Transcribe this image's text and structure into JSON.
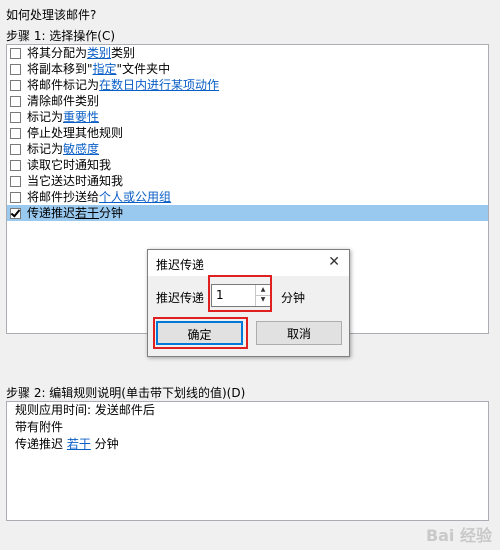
{
  "header": {
    "question": "如何处理该邮件?",
    "step1_label": "步骤 1: 选择操作(C)"
  },
  "actions": [
    {
      "parts": [
        {
          "t": "将其分配为 "
        },
        {
          "t": "类别",
          "link": true
        },
        {
          "t": " 类别"
        }
      ],
      "checked": false
    },
    {
      "parts": [
        {
          "t": "将副本移到\""
        },
        {
          "t": "指定",
          "link": true
        },
        {
          "t": "\"文件夹中"
        }
      ],
      "checked": false
    },
    {
      "parts": [
        {
          "t": "将邮件标记为 "
        },
        {
          "t": "在数日内进行某项动作",
          "link": true
        }
      ],
      "checked": false
    },
    {
      "parts": [
        {
          "t": "清除邮件类别"
        }
      ],
      "checked": false
    },
    {
      "parts": [
        {
          "t": "标记为 "
        },
        {
          "t": "重要性",
          "link": true
        }
      ],
      "checked": false
    },
    {
      "parts": [
        {
          "t": "停止处理其他规则"
        }
      ],
      "checked": false
    },
    {
      "parts": [
        {
          "t": "标记为 "
        },
        {
          "t": "敏感度",
          "link": true
        }
      ],
      "checked": false
    },
    {
      "parts": [
        {
          "t": "读取它时通知我"
        }
      ],
      "checked": false
    },
    {
      "parts": [
        {
          "t": "当它送达时通知我"
        }
      ],
      "checked": false
    },
    {
      "parts": [
        {
          "t": "将邮件抄送给 "
        },
        {
          "t": "个人或公用组",
          "link": true
        }
      ],
      "checked": false
    },
    {
      "parts": [
        {
          "t": "传递推迟 "
        },
        {
          "t": "若干",
          "link": true
        },
        {
          "t": " 分钟"
        }
      ],
      "checked": true,
      "selected": true
    }
  ],
  "step2": {
    "label": "步骤 2: 编辑规则说明(单击带下划线的值)(D)",
    "line1": "规则应用时间: 发送邮件后",
    "line2": "带有附件",
    "line3_prefix": "传递推迟 ",
    "line3_link": "若干",
    "line3_suffix": " 分钟"
  },
  "dialog": {
    "title": "推迟传递",
    "close_glyph": "✕",
    "field_label": "推迟传递",
    "value": "1",
    "unit": "分钟",
    "ok_label": "确定",
    "cancel_label": "取消"
  },
  "watermark": "Bai 经验",
  "colors": {
    "link": "#0a5fc7",
    "selection": "#99c9ef",
    "highlight_box": "#e02020",
    "default_button_border": "#0078d7"
  }
}
